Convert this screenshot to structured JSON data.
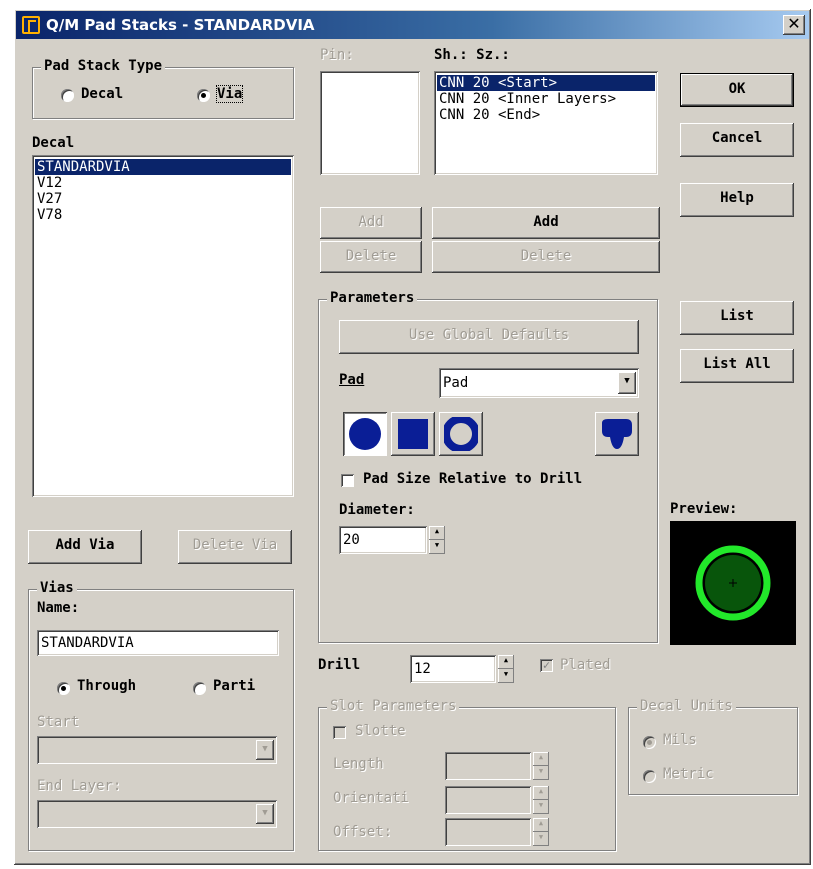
{
  "window": {
    "title": "Q/M Pad Stacks - STANDARDVIA",
    "close_label": "✕"
  },
  "pad_stack_type": {
    "legend": "Pad Stack Type",
    "options": [
      {
        "label": "Decal",
        "checked": false
      },
      {
        "label": "Via",
        "checked": true
      }
    ]
  },
  "decal": {
    "label": "Decal",
    "items": [
      {
        "label": "STANDARDVIA",
        "selected": true
      },
      {
        "label": "V12",
        "selected": false
      },
      {
        "label": "V27",
        "selected": false
      },
      {
        "label": "V78",
        "selected": false
      }
    ]
  },
  "via_buttons": {
    "add": "Add Via",
    "delete": "Delete Via"
  },
  "vias": {
    "legend": "Vias",
    "name_label": "Name:",
    "name_value": "STANDARDVIA",
    "through_label": "Through",
    "partial_label": "Parti",
    "start_label": "Start",
    "end_layer_label": "End Layer:"
  },
  "pin": {
    "label": "Pin:"
  },
  "shape_size": {
    "label": "Sh.: Sz.:",
    "items": [
      {
        "label": "CNN 20 <Start>",
        "selected": true
      },
      {
        "label": "CNN 20 <Inner Layers>",
        "selected": false
      },
      {
        "label": "CNN 20 <End>",
        "selected": false
      }
    ]
  },
  "pin_buttons": {
    "add": "Add",
    "delete": "Delete"
  },
  "shape_buttons": {
    "add": "Add",
    "delete": "Delete"
  },
  "parameters": {
    "legend": "Parameters",
    "use_global_defaults": "Use Global Defaults",
    "pad_label": "Pad",
    "pad_select_value": "Pad",
    "pad_shapes": [
      "round-pad-icon",
      "square-pad-icon",
      "annular-pad-icon",
      "odd-shape-pad-icon"
    ],
    "relative_to_drill_label": "Pad Size Relative to Drill",
    "diameter_label": "Diameter:",
    "diameter_value": "20"
  },
  "drill": {
    "label": "Drill",
    "value": "12",
    "plated_label": "Plated",
    "plated_checked": true
  },
  "slot_parameters": {
    "legend": "Slot Parameters",
    "slotted_label": "Slotte",
    "length_label": "Length",
    "orientation_label": "Orientati",
    "offset_label": "Offset:"
  },
  "decal_units": {
    "legend": "Decal Units",
    "mils_label": "Mils",
    "metric_label": "Metric"
  },
  "buttons": {
    "ok": "OK",
    "cancel": "Cancel",
    "help": "Help",
    "list": "List",
    "list_all": "List All"
  },
  "preview": {
    "label": "Preview:",
    "pad_color": "#22e82a",
    "drill_color": "#22e82a"
  }
}
